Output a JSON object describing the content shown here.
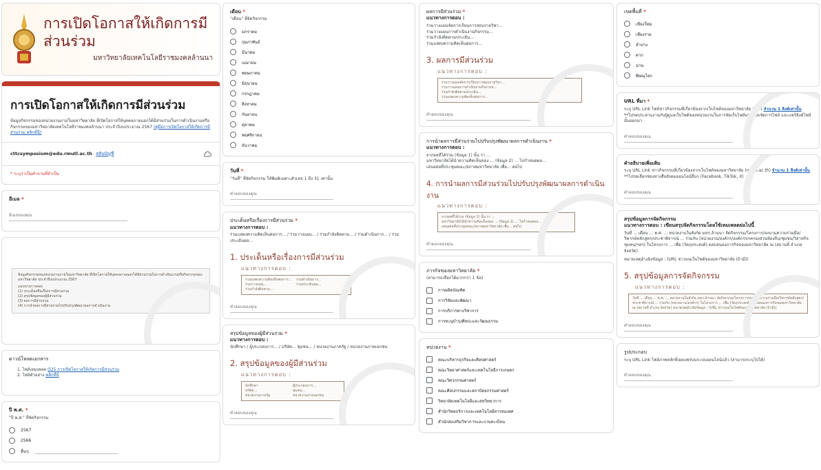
{
  "header": {
    "banner_title": "การเปิดโอกาสให้เกิดการมีส่วนร่วม",
    "banner_subtitle": "มหาวิทยาลัยเทคโนโลยีราชมงคลล้านนา",
    "form_title": "การเปิดโอกาสให้เกิดการมีส่วนร่วม",
    "description": "ข้อมูลกิจกรรมของหน่วยงานภายในมหาวิทยาลัย ที่เปิดโอกาสให้บุคคลภายนอกได้มีส่วนร่วมในการดำเนินงานหรือกิจกรรมของมหาวิทยาลัยเทคโนโลยีราชมงคลล้านนา ประจำปีงบประมาณ 2567",
    "desc_link": "(คู่มือการเปิดโอกาสให้เกิดการมีส่วนร่วม คลิกที่นี่)",
    "account": "cttcsymposium@edu.rmutl.ac.th",
    "switch_account": "สลับบัญชี",
    "required_note": "* ระบุว่าเป็นคำถามที่จำเป็น"
  },
  "email": {
    "label": "อีเมล",
    "placeholder": "อีเมลของคุณ"
  },
  "info_image": {
    "title": "ข้อมูลกิจกรรมของหน่วยงานภายในมหาวิทยาลัย ที่เปิดโอกาสให้บุคคลภายนอกได้มีส่วนร่วมในการดำเนินงานหรือกิจกรรมของมหาวิทยาลัย ประจำปีงบประมาณ 2567",
    "lines": [
      "แนวทางการตอบ",
      "(1) ประเด็นหรือเรื่องการมีส่วนร่วม",
      "(2) สรุปข้อมูลของผู้มีส่วนร่วม",
      "(3) ผลการมีส่วนร่วม",
      "(4) การนำผลการมีส่วนร่วมไปปรับปรุงพัฒนาผลการดำเนินงาน"
    ]
  },
  "downloads": {
    "title": "ดาวน์โหลดเอกสาร",
    "items": [
      {
        "text": "1. ไฟล์เทมเพลต",
        "link": "O25 การเปิดโอกาสให้เกิดการมีส่วนร่วม"
      },
      {
        "text": "2. ไฟล์ตัวอย่าง",
        "link": "คลิกที่นี่"
      }
    ]
  },
  "year": {
    "label": "ปี พ.ศ.",
    "hint": "\"ปี พ.ศ.\" ที่จัดกิจกรรม",
    "options": [
      "2567",
      "2566",
      "อื่นๆ:"
    ]
  },
  "month": {
    "label": "เดือน",
    "hint": "\"เดือน\" ที่จัดกิจกรรม",
    "options": [
      "มกราคม",
      "กุมภาพันธ์",
      "มีนาคม",
      "เมษายน",
      "พฤษภาคม",
      "มิถุนายน",
      "กรกฎาคม",
      "สิงหาคม",
      "กันยายน",
      "ตุลาคม",
      "พฤศจิกายน",
      "ธันวาคม"
    ]
  },
  "day": {
    "label": "วันที่",
    "hint": "\"วันที่\" ที่จัดกิจกรรม ให้พิมพ์เฉพาะตัวเลข 1 ถึง 31 เท่านั้น",
    "placeholder": "คำตอบของคุณ"
  },
  "issue": {
    "label": "ประเด็นหรือเรื่องการมีส่วนร่วม",
    "guide": "แนวทางการตอบ :",
    "desc": "ร่วมแสดงความคิดเห็นต่อการ... / ร่วมวางแผน... / ร่วมกำลังติดตาม... / ร่วมดำเนินการ... / ร่วมประเมินผล...",
    "big": "1. ประเด็นหรือเรื่องการมีส่วนร่วม",
    "bigw": "แนวทางการตอบ :",
    "ph": [
      "ร่วมแสดงความคิดเห็นต่อการ...",
      "ร่วมดำเนินการ...",
      "ร่วมวางแผน...",
      "ร่วมประเมินผล...",
      "ร่วมกำลังติดตาม..."
    ],
    "placeholder": "คำตอบของคุณ"
  },
  "participants": {
    "label": "สรุปข้อมูลของผู้มีส่วนร่วม",
    "guide": "แนวทางการตอบ :",
    "desc": "นักศึกษา / ผู้ประกอบการ... / บริษัท... ชุมชน... / หน่วยงานภาครัฐ / หน่วยงานภาคเอกชน",
    "big": "2. สรุปข้อมูลของผู้มีส่วนร่วม",
    "bigw": "แนวทางการตอบ :",
    "ph": [
      "นักศึกษา",
      "ผู้ประกอบการ...",
      "บริษัท...",
      "ชุมชน...",
      "หน่วยงานภาครัฐ",
      "หน่วยงานภาคเอกชน"
    ],
    "placeholder": "คำตอบของคุณ"
  },
  "results": {
    "label": "ผลการมีส่วนร่วม",
    "guide": "แนวทางการตอบ :",
    "lines": [
      "ร่วมวางแผนจัดการเรียนการสอนรายวิชา...",
      "ร่วมวางแผนการดำเนินงานกิจกรรม...",
      "ร่วมกำลังติดตามประเมิน...",
      "ร่วมแสดงความคิดเห็นต่อการ..."
    ],
    "big": "3. ผลการมีส่วนร่วม",
    "bigw": "แนวทางการตอบ :",
    "placeholder": "คำตอบของคุณ"
  },
  "improve": {
    "label": "การนำผลการมีส่วนร่วมไปปรับปรุงพัฒนาผลการดำเนินงาน",
    "guide": "แนวทางการตอบ :",
    "lines": [
      "จากผลที่ได้ร่วม (ข้อมูล 1) นั้น รา ...",
      "มหาวิทยาลัยได้นำความคิดเห็นของ ... (ข้อมูล 2) ... ไปกำหนดผล...",
      "เสนอต่อที่ประชุมคณะ/สภาพมหาวิทยาลัย เพื่อ... ต่อไป"
    ],
    "big": "4. การนำผลการมีส่วนร่วมไปปรับปรุงพัฒนาผลการดำเนินงาน",
    "bigw": "แนวทางการตอบ :",
    "placeholder": "คำตอบของคุณ"
  },
  "mission": {
    "label": "ภารกิจของมหาวิทยาลัย",
    "hint": "(สามารถเลือกได้มากกว่า 1 ข้อ)",
    "options": [
      "การผลิตบัณฑิต",
      "การวิจัยและพัฒนา",
      "การบริการทางวิชาการ",
      "การทะนุบำรุงศิลปะและวัฒนธรรม"
    ]
  },
  "unit": {
    "label": "หน่วยงาน",
    "options": [
      "คณะบริหารธุรกิจและศิลปศาสตร์",
      "คณะวิทยาศาสตร์และเทคโนโลยีการเกษตร",
      "คณะวิศวกรรมศาสตร์",
      "คณะศิลปกรรมและสถาปัตยกรรมศาสตร์",
      "วิทยาลัยเทคโนโลยีและสหวิทยาการ",
      "สำนักวิทยบริการและเทคโนโลยีสารสนเทศ",
      "สำนักส่งเสริมวิชาการและงานทะเบียน"
    ]
  },
  "zone": {
    "label": "เขตพื้นที่",
    "options": [
      "เชียงใหม่",
      "เชียงราย",
      "ลำปาง",
      "ตาก",
      "น่าน",
      "พิษณุโลก"
    ]
  },
  "url_source": {
    "label": "URL ที่มา",
    "desc": "ระบุ URL Link ไฟล์ข่าวกิจกรรมที่เกี่ยวข้องจากเว็บไซต์ของมหาวิทยาลัย (pdf)",
    "desc_link": "จำนวน 1 ลิงค์เท่านั้น",
    "desc2": "**โปรดประสานงานกับผู้ดูแลเว็บไซต์ของหน่วยงานในการจัดเก็บไฟล์บนระบบจัดการไฟล์ และแชร์ลิงค์ไฟล์นั้นออกมา",
    "placeholder": "คำตอบของคุณ"
  },
  "extra": {
    "label": "คำอธิบายเพิ่มเติม",
    "desc": "ระบุ URL Link ข่าวกิจกรรมที่เกี่ยวข้องจากเว็บไซต์ของมหาวิทยาลัย (rmutl.ac.th)",
    "desc_link": "จำนวน 1 ลิงค์เท่านั้น",
    "desc2": "**โปรดเลือกช่องทางสื่อสังคมออนไลน์อื่นๆ (Facebook, TikTok, X)",
    "placeholder": "คำตอบของคุณ"
  },
  "summary": {
    "label": "สรุปข้อมูลการจัดกิจกรรม",
    "guide": "แนวทางการตอบ : เขียนสรุปจัดกิจกรรมโดยใช้เทมเพลตย่อไปนี้",
    "desc": "วันที่ ... เดือน ... พ.ศ. ... หน่วยงานในสังกัด มทร.ล้านนา จัดกิจกรรม/โครงการ/ลงนามความร่วมมือ/วิพากษ์หลักสูตร/ประชาพิจารณ์ ... ร่วมกับ (หน่วยงาน/องค์กร/องค์กรปกครองส่วนท้องถิ่น/ชุมชน/วิสาหกิจชุมชน/ฯลฯ) ในโครงการ ... เพื่อ (วัตถุประสงค์) ตอบสนองภารกิจของมหาวิทยาลัย ณ (สถานที่ อำเภอ จังหวัด)",
    "desc2": "หมายเหตุอ้างอิงข้อมูล : (URL ข่าวบนเว็บไซต์ของมหาวิทยาลัย (ถ้ามี))",
    "big": "5. สรุปข้อมูลการจัดกิจกรรม",
    "bigw": "แนวทางการตอบ :",
    "ph": "วันที่ ... เดือน ... พ.ศ. ... หน่วยงานในสังกัด มทร.ล้านนา จัดกิจกรรม/โครงการ/ลงนามความร่วมมือ/วิพากษ์หลักสูตร/ประชาพิจารณ์ ... ร่วมกับ (หน่วยงาน/องค์กร) ในโครงการ ... เพื่อ (วัตถุประสงค์) ตอบสนองภารกิจของมหาวิทยาลัย ณ (สถานที่ อำเภอ จังหวัด) หมายเหตุอ้างอิงข้อมูล : (URL ข่าวบนเว็บไซต์ของมหาวิทยาลัย (ถ้ามี))",
    "placeholder": "คำตอบของคุณ"
  },
  "photo": {
    "label": "รูปประกอบ",
    "desc": "ระบุ URL Link ไฟล์ภาพหลักที่เผยแพร่บนระบบออนไลน์แล้ว (สามารถระบุไปได้)",
    "placeholder": "คำตอบของคุณ"
  },
  "colors": {
    "accent": "#c0392b",
    "border": "#dadce0",
    "heading_brown": "#8c3b2d",
    "link": "#1a5fb4",
    "required": "#d93025"
  }
}
